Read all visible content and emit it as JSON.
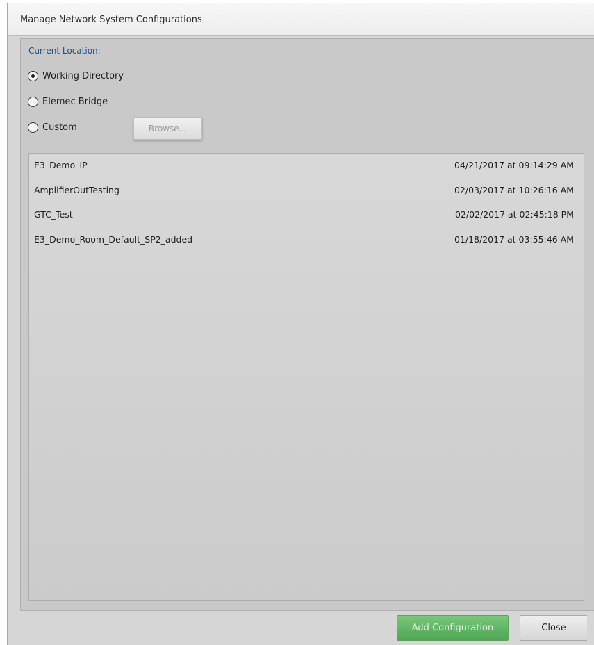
{
  "dialog": {
    "title": "Manage Network System Configurations"
  },
  "location": {
    "label": "Current Location:",
    "options": [
      {
        "label": "Working Directory",
        "checked": true
      },
      {
        "label": "Elemec Bridge",
        "checked": false
      },
      {
        "label": "Custom",
        "checked": false
      }
    ],
    "browse_label": "Browse..."
  },
  "configurations": [
    {
      "name": "E3_Demo_IP",
      "date": "04/21/2017 at 09:14:29 AM"
    },
    {
      "name": "AmplifierOutTesting",
      "date": "02/03/2017 at 10:26:16 AM"
    },
    {
      "name": "GTC_Test",
      "date": "02/02/2017 at 02:45:18 PM"
    },
    {
      "name": "E3_Demo_Room_Default_SP2_added",
      "date": "01/18/2017 at 03:55:46 AM"
    }
  ],
  "footer": {
    "add_label": "Add Configuration",
    "close_label": "Close"
  }
}
